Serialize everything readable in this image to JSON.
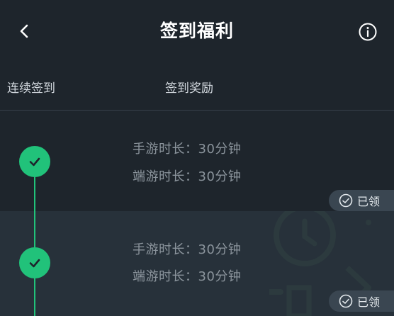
{
  "header": {
    "title": "签到福利",
    "back_icon": "chevron-left-icon",
    "info_icon": "info-icon"
  },
  "columns": {
    "streak": "连续签到",
    "reward": "签到奖励"
  },
  "rows": [
    {
      "mobile_time": "手游时长：30分钟",
      "pc_time": "端游时长：30分钟",
      "status": "已领",
      "checked": true
    },
    {
      "mobile_time": "手游时长：30分钟",
      "pc_time": "端游时长：30分钟",
      "status": "已领",
      "checked": true
    }
  ],
  "colors": {
    "background": "#1e252c",
    "row_alt": "#27313a",
    "accent": "#21c27a",
    "badge": "#3a4651"
  }
}
